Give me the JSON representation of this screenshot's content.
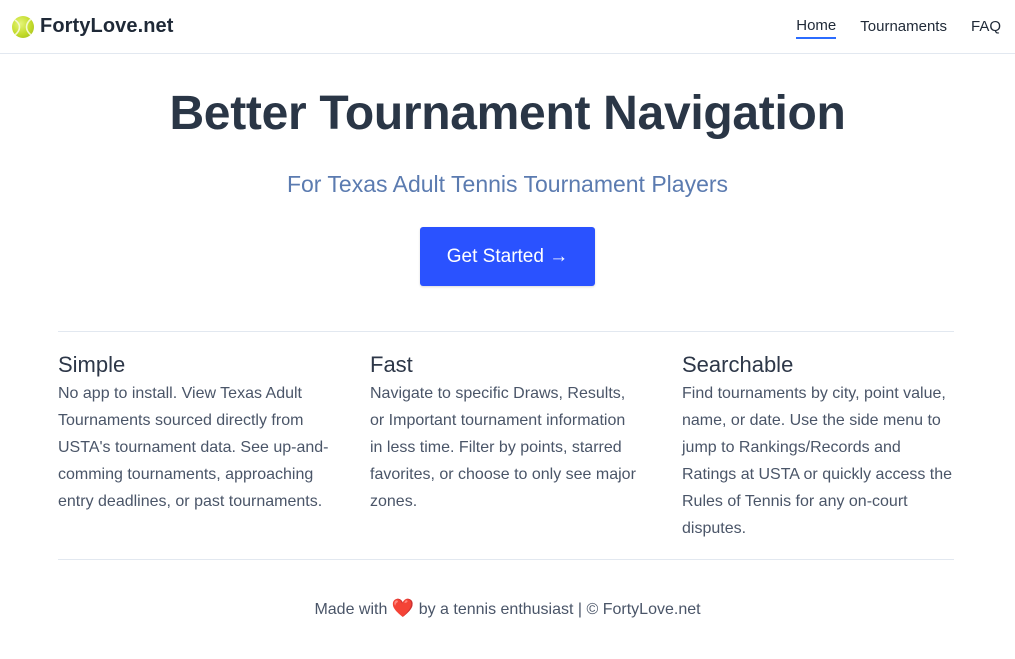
{
  "navbar": {
    "brand": "FortyLove.net",
    "brand_icon": "tennis-ball-icon",
    "links": [
      {
        "label": "Home",
        "active": true
      },
      {
        "label": "Tournaments",
        "active": false
      },
      {
        "label": "FAQ",
        "active": false
      }
    ]
  },
  "hero": {
    "title": "Better Tournament Navigation",
    "subtitle": "For Texas Adult Tennis Tournament Players",
    "cta_label": "Get Started →"
  },
  "features": [
    {
      "title": "Simple",
      "text": "No app to install. View Texas Adult Tournaments sourced directly from USTA's tournament data. See up-and-comming tournaments, approaching entry deadlines, or past tournaments."
    },
    {
      "title": "Fast",
      "text": "Navigate to specific Draws, Results, or Important tournament information in less time. Filter by points, starred favorites, or choose to only see major zones."
    },
    {
      "title": "Searchable",
      "text": "Find tournaments by city, point value, name, or date. Use the side menu to jump to Rankings/Records and Ratings at USTA or quickly access the Rules of Tennis for any on-court disputes."
    }
  ],
  "footer": {
    "made_with": "Made with",
    "heart": "❤️",
    "rest": "by a tennis enthusiast | © FortyLove.net"
  },
  "colors": {
    "accent": "#2a52ff",
    "title": "#2a3646",
    "subtitle": "#5b7bb0"
  }
}
